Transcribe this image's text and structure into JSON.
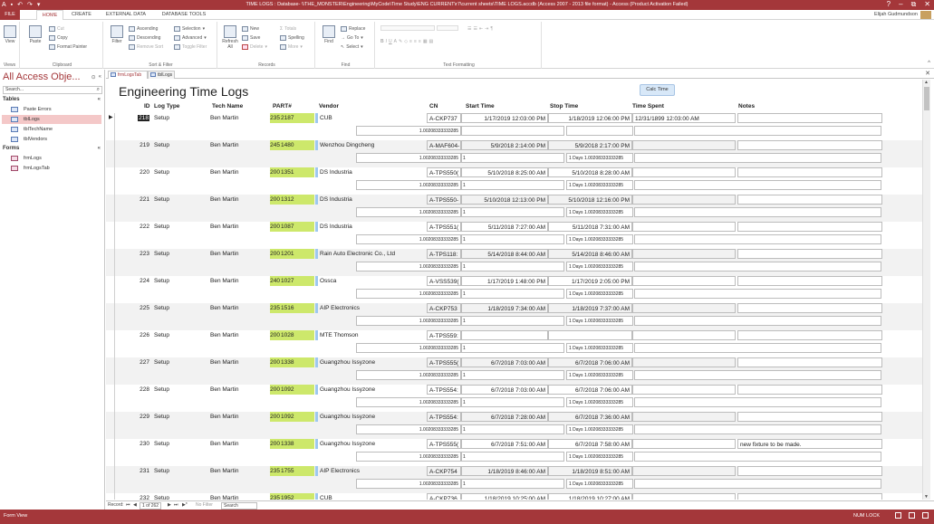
{
  "window": {
    "title": "TIME LOGS : Database- \\\\THE_MONSTER\\Engineering\\MyCode\\Time Study\\ENG CURRENT\\r7\\current sheets\\TIME LOGS.accdb (Access 2007 - 2013 file format) - Access (Product Activation Failed)",
    "controls": [
      "?",
      "–",
      "⧉",
      "✕"
    ]
  },
  "ribbon_tabs": {
    "file": "FILE",
    "home": "HOME",
    "create": "CREATE",
    "external_data": "EXTERNAL DATA",
    "database_tools": "DATABASE TOOLS"
  },
  "user": {
    "name": "Elijah Gudmundson"
  },
  "ribbon": {
    "views": {
      "view": "View",
      "label": "Views"
    },
    "clipboard": {
      "paste": "Paste",
      "cut": "Cut",
      "copy": "Copy",
      "format_painter": "Format Painter",
      "label": "Clipboard"
    },
    "sort_filter": {
      "filter": "Filter",
      "ascending": "Ascending",
      "descending": "Descending",
      "remove_sort": "Remove Sort",
      "selection": "Selection",
      "advanced": "Advanced",
      "toggle_filter": "Toggle Filter",
      "label": "Sort & Filter"
    },
    "records": {
      "refresh": "Refresh",
      "refresh_all": "All",
      "new": "New",
      "save": "Save",
      "delete": "Delete",
      "totals": "Totals",
      "spelling": "Spelling",
      "more": "More",
      "label": "Records"
    },
    "find": {
      "find": "Find",
      "replace": "Replace",
      "goto": "Go To",
      "select": "Select",
      "label": "Find"
    },
    "text_formatting": {
      "label": "Text Formatting"
    }
  },
  "nav_pane": {
    "title": "All Access Obje...",
    "search_placeholder": "Search...",
    "tables_label": "Tables",
    "tables": [
      "Paste Errors",
      "tblLogs",
      "tblTechName",
      "tblVendors"
    ],
    "forms_label": "Forms",
    "forms": [
      "frmLogs",
      "frmLogsTab"
    ]
  },
  "doc_tabs": [
    "frmLogsTab",
    "tblLogs"
  ],
  "form": {
    "title": "Engineering Time Logs",
    "calc_button": "Calc Time",
    "headers": [
      "ID",
      "Log Type",
      "Tech Name",
      "PART#",
      "Vendor",
      "CN",
      "Start Time",
      "Stop Time",
      "Time Spent",
      "Notes"
    ],
    "records": [
      {
        "id": "218",
        "log_type": "Setup",
        "tech": "Ben Martin",
        "part_a": "235",
        "part_b": "2187",
        "vendor": "CUB",
        "cn": "A-CKP737",
        "start": "1/17/2019 12:03:00 PM",
        "stop": "1/18/2019 12:06:00 PM",
        "spent": "12/31/1899 12:03:00 AM",
        "notes": "",
        "calc_a": "1.00208333333285",
        "calc_b": "",
        "calc_c": "",
        "calc_d": ""
      },
      {
        "id": "219",
        "log_type": "Setup",
        "tech": "Ben Martin",
        "part_a": "245",
        "part_b": "1480",
        "vendor": "Wenzhou Dingcheng",
        "cn": "A-MAF604-",
        "start": "5/9/2018 2:14:00 PM",
        "stop": "5/9/2018 2:17:00 PM",
        "spent": "",
        "notes": "",
        "calc_a": "1.00208333333285",
        "calc_b": "1",
        "calc_c": "1 Days 1.00208333333285",
        "calc_d": ""
      },
      {
        "id": "220",
        "log_type": "Setup",
        "tech": "Ben Martin",
        "part_a": "200",
        "part_b": "1351",
        "vendor": "DS Industria",
        "cn": "A-TPS550(",
        "start": "5/10/2018 8:25:00 AM",
        "stop": "5/10/2018 8:28:00 AM",
        "spent": "",
        "notes": "",
        "calc_a": "1.00208333333285",
        "calc_b": "1",
        "calc_c": "1 Days 1.00208333333285",
        "calc_d": ""
      },
      {
        "id": "221",
        "log_type": "Setup",
        "tech": "Ben Martin",
        "part_a": "200",
        "part_b": "1312",
        "vendor": "DS Industria",
        "cn": "A-TPS550-",
        "start": "5/10/2018 12:13:00 PM",
        "stop": "5/10/2018 12:16:00 PM",
        "spent": "",
        "notes": "",
        "calc_a": "1.00208333333285",
        "calc_b": "1",
        "calc_c": "1 Days 1.00208333333285",
        "calc_d": ""
      },
      {
        "id": "222",
        "log_type": "Setup",
        "tech": "Ben Martin",
        "part_a": "200",
        "part_b": "1087",
        "vendor": "DS Industria",
        "cn": "A-TPS551(",
        "start": "5/11/2018 7:27:00 AM",
        "stop": "5/11/2018 7:31:00 AM",
        "spent": "",
        "notes": "",
        "calc_a": "1.00208333333285",
        "calc_b": "1",
        "calc_c": "1 Days 1.00208333333285",
        "calc_d": ""
      },
      {
        "id": "223",
        "log_type": "Setup",
        "tech": "Ben Martin",
        "part_a": "200",
        "part_b": "1201",
        "vendor": "Rain Auto Electronic Co., Ltd",
        "cn": "A-TPS118:",
        "start": "5/14/2018 8:44:00 AM",
        "stop": "5/14/2018 8:46:00 AM",
        "spent": "",
        "notes": "",
        "calc_a": "1.00208333333285",
        "calc_b": "1",
        "calc_c": "1 Days 1.00208333333285",
        "calc_d": ""
      },
      {
        "id": "224",
        "log_type": "Setup",
        "tech": "Ben Martin",
        "part_a": "240",
        "part_b": "1027",
        "vendor": "Ossca",
        "cn": "A-VSS539(",
        "start": "1/17/2019 1:48:00 PM",
        "stop": "1/17/2019 2:05:00 PM",
        "spent": "",
        "notes": "",
        "calc_a": "1.00208333333285",
        "calc_b": "1",
        "calc_c": "1 Days 1.00208333333285",
        "calc_d": ""
      },
      {
        "id": "225",
        "log_type": "Setup",
        "tech": "Ben Martin",
        "part_a": "235",
        "part_b": "1516",
        "vendor": "AIP Electronics",
        "cn": "A-CKP753",
        "start": "1/18/2019 7:34:00 AM",
        "stop": "1/18/2019 7:37:00 AM",
        "spent": "",
        "notes": "",
        "calc_a": "1.00208333333285",
        "calc_b": "1",
        "calc_c": "1 Days 1.00208333333285",
        "calc_d": ""
      },
      {
        "id": "226",
        "log_type": "Setup",
        "tech": "Ben Martin",
        "part_a": "200",
        "part_b": "1028",
        "vendor": "MTE Thomson",
        "cn": "A-TPS559:",
        "start": "",
        "stop": "",
        "spent": "",
        "notes": "",
        "calc_a": "1.00208333333285",
        "calc_b": "1",
        "calc_c": "1 Days 1.00208333333285",
        "calc_d": ""
      },
      {
        "id": "227",
        "log_type": "Setup",
        "tech": "Ben Martin",
        "part_a": "200",
        "part_b": "1338",
        "vendor": "Guangzhou Issyzone",
        "cn": "A-TPS555(",
        "start": "6/7/2018 7:03:00 AM",
        "stop": "6/7/2018 7:06:00 AM",
        "spent": "",
        "notes": "",
        "calc_a": "1.00208333333285",
        "calc_b": "1",
        "calc_c": "1 Days 1.00208333333285",
        "calc_d": ""
      },
      {
        "id": "228",
        "log_type": "Setup",
        "tech": "Ben Martin",
        "part_a": "200",
        "part_b": "1092",
        "vendor": "Guangzhou Issyzone",
        "cn": "A-TPS554:",
        "start": "6/7/2018 7:03:00 AM",
        "stop": "6/7/2018 7:06:00 AM",
        "spent": "",
        "notes": "",
        "calc_a": "1.00208333333285",
        "calc_b": "1",
        "calc_c": "1 Days 1.00208333333285",
        "calc_d": ""
      },
      {
        "id": "229",
        "log_type": "Setup",
        "tech": "Ben Martin",
        "part_a": "200",
        "part_b": "1092",
        "vendor": "Guangzhou Issyzone",
        "cn": "A-TPS554:",
        "start": "6/7/2018 7:28:00 AM",
        "stop": "6/7/2018 7:36:00 AM",
        "spent": "",
        "notes": "",
        "calc_a": "1.00208333333285",
        "calc_b": "1",
        "calc_c": "1 Days 1.00208333333285",
        "calc_d": ""
      },
      {
        "id": "230",
        "log_type": "Setup",
        "tech": "Ben Martin",
        "part_a": "200",
        "part_b": "1338",
        "vendor": "Guangzhou Issyzone",
        "cn": "A-TPS555(",
        "start": "6/7/2018 7:51:00 AM",
        "stop": "6/7/2018 7:58:00 AM",
        "spent": "",
        "notes": "new fixture to be made.",
        "calc_a": "1.00208333333285",
        "calc_b": "1",
        "calc_c": "1 Days 1.00208333333285",
        "calc_d": ""
      },
      {
        "id": "231",
        "log_type": "Setup",
        "tech": "Ben Martin",
        "part_a": "235",
        "part_b": "1755",
        "vendor": "AIP Electronics",
        "cn": "A-CKP754",
        "start": "1/18/2019 8:46:00 AM",
        "stop": "1/18/2019 8:51:00 AM",
        "spent": "",
        "notes": "",
        "calc_a": "1.00208333333285",
        "calc_b": "1",
        "calc_c": "1 Days 1.00208333333285",
        "calc_d": ""
      },
      {
        "id": "232",
        "log_type": "Setup",
        "tech": "Ben Martin",
        "part_a": "235",
        "part_b": "1952",
        "vendor": "CUB",
        "cn": "A-CKP736",
        "start": "1/18/2019 10:25:00 AM",
        "stop": "1/18/2019 10:27:00 AM",
        "spent": "",
        "notes": "",
        "calc_a": "",
        "calc_b": "",
        "calc_c": "",
        "calc_d": ""
      }
    ]
  },
  "record_nav": {
    "label": "Record:",
    "first": "⏮",
    "prev": "◀",
    "position": "1 of 262",
    "next": "▶",
    "last": "⏭",
    "new": "▶*",
    "filter": "No Filter",
    "search": "Search"
  },
  "status": {
    "view": "Form View",
    "numlock": "NUM LOCK"
  },
  "colors": {
    "accent": "#a4373a",
    "part_highlight": "#cde86b",
    "vendor_border": "#9ec8ef"
  }
}
